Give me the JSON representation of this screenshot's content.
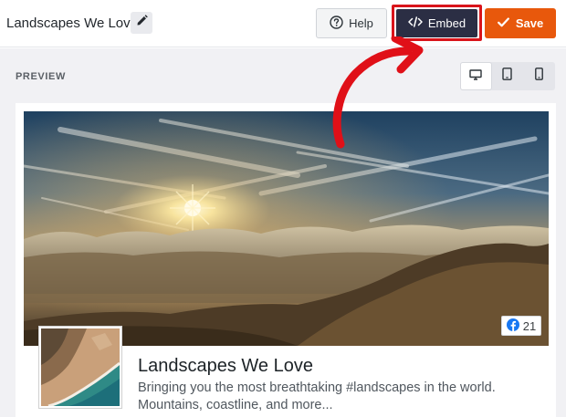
{
  "header": {
    "title": "Landscapes We Love",
    "help_label": "Help",
    "embed_label": "Embed",
    "save_label": "Save"
  },
  "preview": {
    "label": "PREVIEW",
    "devices": [
      "desktop-icon",
      "tablet-icon",
      "mobile-icon"
    ],
    "active_device": "desktop"
  },
  "feed": {
    "title": "Landscapes We Love",
    "description": "Bringing you the most breathtaking #landscapes in the world. Mountains, coastline, and more...",
    "facebook_count": "21"
  },
  "colors": {
    "embed_bg": "#2b2e44",
    "save_bg": "#e8580c",
    "highlight": "#d9141b",
    "facebook": "#1877f2"
  }
}
